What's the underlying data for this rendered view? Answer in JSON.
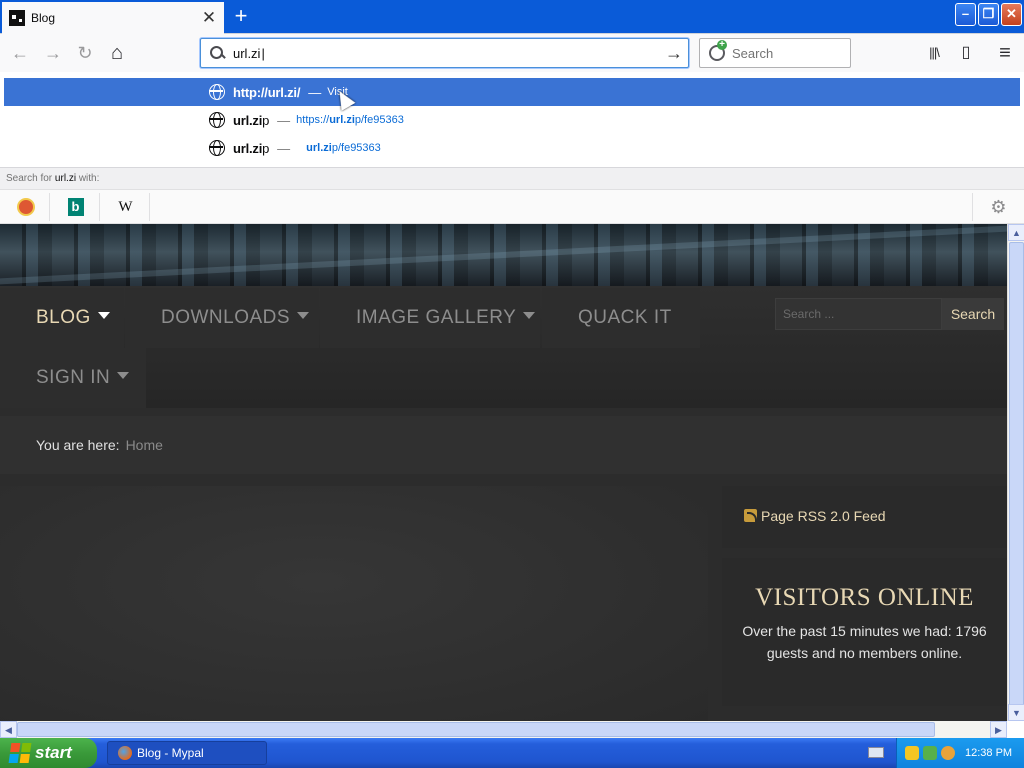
{
  "browser": {
    "tab_title": "Blog",
    "tab_close": "✕",
    "newtab": "+",
    "window": {
      "minimize": "–",
      "restore": "❐",
      "close": "✕"
    },
    "nav": {
      "back": "←",
      "forward": "→",
      "reload": "↻",
      "home": "⌂"
    },
    "url_value": "url.zi",
    "url_go": "→",
    "search_placeholder": "Search",
    "tools": {
      "library": "|||\\",
      "sidebar": "▯",
      "menu": "≡"
    }
  },
  "autocomplete": {
    "results": [
      {
        "title_bold": "http://url.zi/",
        "title_rest": "",
        "sep": "—",
        "action": "Visit",
        "url_bold": "",
        "url_rest": ""
      },
      {
        "title_bold": "url.zi",
        "title_rest": "p",
        "sep": "—",
        "action": "",
        "url_prefix": "https://",
        "url_bold": "url.zi",
        "url_rest": "p/fe95363"
      },
      {
        "title_bold": "url.zi",
        "title_rest": "p",
        "sep": "—",
        "action": "",
        "url_prefix": "",
        "url_bold": "url.zi",
        "url_rest": "p/fe95363"
      }
    ],
    "search_for_prefix": "Search for ",
    "search_for_term": "url.zi",
    "search_for_suffix": " with:",
    "engines": [
      {
        "name": "duckduckgo-icon",
        "glyph": ""
      },
      {
        "name": "bing-icon",
        "glyph": "b"
      },
      {
        "name": "wikipedia-icon",
        "glyph": "W"
      }
    ],
    "settings_glyph": "⚙"
  },
  "site": {
    "menu": [
      {
        "label": "BLOG",
        "has_caret": true,
        "active": true
      },
      {
        "label": "DOWNLOADS",
        "has_caret": true
      },
      {
        "label": "IMAGE GALLERY",
        "has_caret": true
      },
      {
        "label": "QUACK IT",
        "has_caret": false
      },
      {
        "label": "SIGN IN",
        "has_caret": true
      }
    ],
    "search_placeholder": "Search ...",
    "search_button": "Search",
    "breadcrumb_label": "You are here:",
    "breadcrumb_home": "Home",
    "rss_label": "Page RSS 2.0 Feed",
    "visitors_title": "VISITORS ONLINE",
    "visitors_text": "Over the past 15 minutes we had: 1796 guests and no members online."
  },
  "scroll": {
    "up": "▲",
    "down": "▼",
    "left": "◀",
    "right": "▶"
  },
  "taskbar": {
    "start_label": "start",
    "task_label": "Blog - Mypal",
    "clock": "12:38 PM"
  },
  "colors": {
    "accent": "#3a73d4",
    "site_gold": "#e8d8b4",
    "taskbar": "#245edb",
    "start_green": "#3a9a3a"
  }
}
